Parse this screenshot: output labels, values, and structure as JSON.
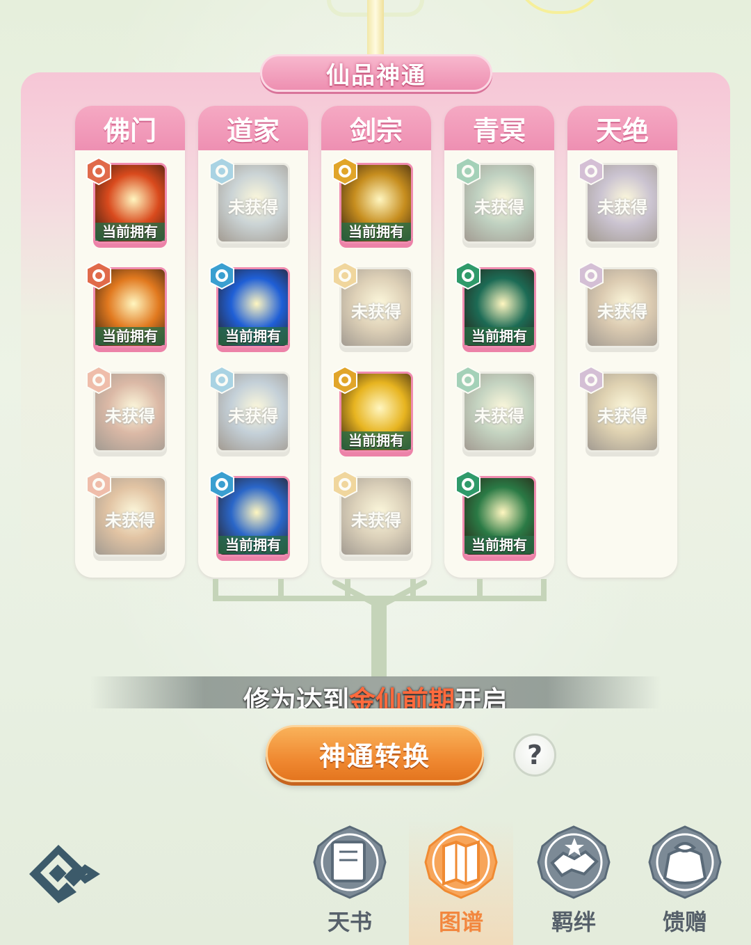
{
  "panel": {
    "title": "仙品神通"
  },
  "columns": [
    {
      "name": "佛门",
      "color": "#e06a4a",
      "cards": [
        {
          "status": "owned",
          "label": "当前拥有",
          "art": "#d94a1d"
        },
        {
          "status": "owned",
          "label": "当前拥有",
          "art": "#e1791f"
        },
        {
          "status": "locked",
          "label": "未获得",
          "art": "#b06040"
        },
        {
          "status": "locked",
          "label": "未获得",
          "art": "#c07a3a"
        }
      ]
    },
    {
      "name": "道家",
      "color": "#3a9fd0",
      "cards": [
        {
          "status": "locked",
          "label": "未获得",
          "art": "#8aa0b0"
        },
        {
          "status": "owned",
          "label": "当前拥有",
          "art": "#1f5fd6"
        },
        {
          "status": "locked",
          "label": "未获得",
          "art": "#7a98b8"
        },
        {
          "status": "owned",
          "label": "当前拥有",
          "art": "#2a66c8"
        }
      ]
    },
    {
      "name": "剑宗",
      "color": "#e1a52a",
      "cards": [
        {
          "status": "owned",
          "label": "当前拥有",
          "art": "#c68d1e"
        },
        {
          "status": "locked",
          "label": "未获得",
          "art": "#b89a6a"
        },
        {
          "status": "owned",
          "label": "当前拥有",
          "art": "#e7b420"
        },
        {
          "status": "locked",
          "label": "未获得",
          "art": "#b29a70"
        }
      ]
    },
    {
      "name": "青冥",
      "color": "#2f9a6a",
      "cards": [
        {
          "status": "locked",
          "label": "未获得",
          "art": "#6f9a80"
        },
        {
          "status": "owned",
          "label": "当前拥有",
          "art": "#1c6b55"
        },
        {
          "status": "locked",
          "label": "未获得",
          "art": "#7aa080"
        },
        {
          "status": "owned",
          "label": "当前拥有",
          "art": "#2a7a45"
        }
      ]
    },
    {
      "name": "天绝",
      "color": "#a070b0",
      "cards": [
        {
          "status": "locked",
          "label": "未获得",
          "art": "#8a7aa6"
        },
        {
          "status": "locked",
          "label": "未获得",
          "art": "#b08a5a"
        },
        {
          "status": "locked",
          "label": "未获得",
          "art": "#b89a5a"
        }
      ]
    }
  ],
  "banner": {
    "prefix": "修为达到",
    "highlight": "金仙前期",
    "suffix": "开启"
  },
  "buttons": {
    "convert": "神通转换",
    "help": "?"
  },
  "nav": [
    {
      "label": "天书",
      "icon": "book-icon",
      "active": false
    },
    {
      "label": "图谱",
      "icon": "map-icon",
      "active": true
    },
    {
      "label": "羁绊",
      "icon": "handshake-icon",
      "active": false
    },
    {
      "label": "馈赠",
      "icon": "gift-bag-icon",
      "active": false
    }
  ],
  "colors": {
    "panel_pink": "#ee8fb1",
    "owned_label_bg": "#286e46",
    "convert_orange": "#f08a32",
    "nav_active": "#f2873f"
  }
}
